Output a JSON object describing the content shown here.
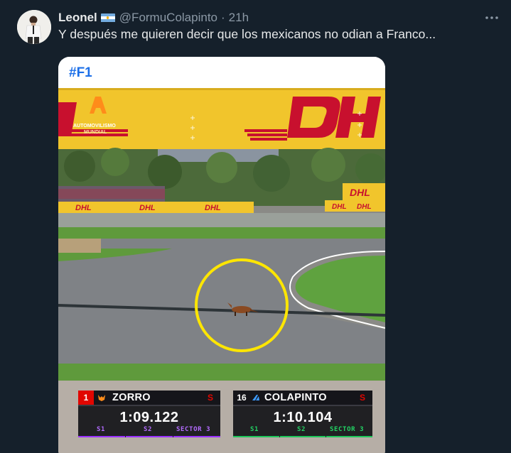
{
  "user": {
    "display_name": "Leonel",
    "handle": "@FormuColapinto",
    "separator": "·",
    "time": "21h",
    "flag_icon": "argentina-flag-icon"
  },
  "tweet": {
    "text": "Y después me quieren decir que los mexicanos no odian a Franco..."
  },
  "media": {
    "hashtag": "#F1",
    "overlay_logo_line1": "AUTOMOVILISMO",
    "overlay_logo_line2": "MUNDIAL",
    "sponsor": "DHL",
    "timing": [
      {
        "position": "1",
        "name": "ZORRO",
        "s_label": "S",
        "lap_time": "1:09.122",
        "sectors": [
          "S1",
          "S2",
          "SECTOR 3"
        ],
        "sector_colors": [
          "#9b30ff",
          "#9b30ff",
          "#9b30ff"
        ]
      },
      {
        "position": "16",
        "name": "COLAPINTO",
        "s_label": "S",
        "lap_time": "1:10.104",
        "sectors": [
          "S1",
          "S2",
          "SECTOR 3"
        ],
        "sector_colors": [
          "#1ec85a",
          "#1ec85a",
          "#1ec85a"
        ]
      }
    ]
  },
  "colors": {
    "background": "#15202b",
    "text_primary": "#e7e9ea",
    "text_secondary": "#8b98a5",
    "hashtag": "#1c6fe8",
    "dhl_yellow": "#f4c92e",
    "dhl_red": "#c8102e",
    "highlight_circle": "#ffe600"
  }
}
